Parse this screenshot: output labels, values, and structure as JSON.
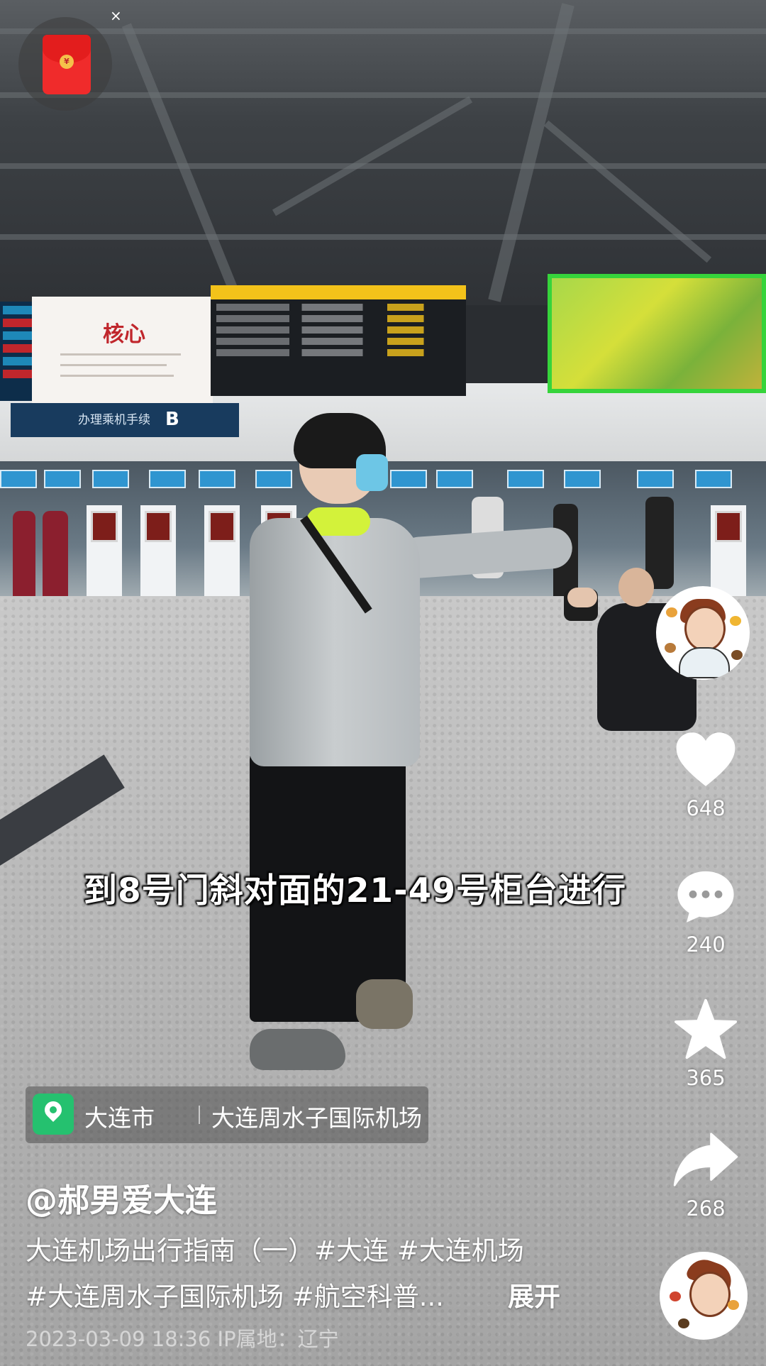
{
  "subtitle": "到8号门斜对面的21-49号柜台进行",
  "actions": {
    "likes": "648",
    "comments": "240",
    "favorites": "365",
    "shares": "268"
  },
  "location": {
    "city": "大连市",
    "place": "大连周水子国际机场"
  },
  "author": "@郝男爱大连",
  "description": {
    "line1": "大连机场出行指南（一）#大连 #大连机场",
    "line2": "#大连周水子国际机场 #航空科普...",
    "expand_label": "展开"
  },
  "meta": "2023-03-09 18:36  IP属地：辽宁",
  "scene_text": {
    "checkin_sign": "办理乘机手续",
    "checkin_letter": "B",
    "poster_word": "核心"
  },
  "icons": {
    "red_packet": "red-packet-icon",
    "close": "close-icon",
    "like": "heart-icon",
    "comment": "comment-icon",
    "favorite": "star-icon",
    "share": "share-icon",
    "location": "location-pin-icon"
  },
  "colors": {
    "location_green": "#25c16f",
    "red_packet": "#f02b2b",
    "icon_white": "#ffffff"
  }
}
